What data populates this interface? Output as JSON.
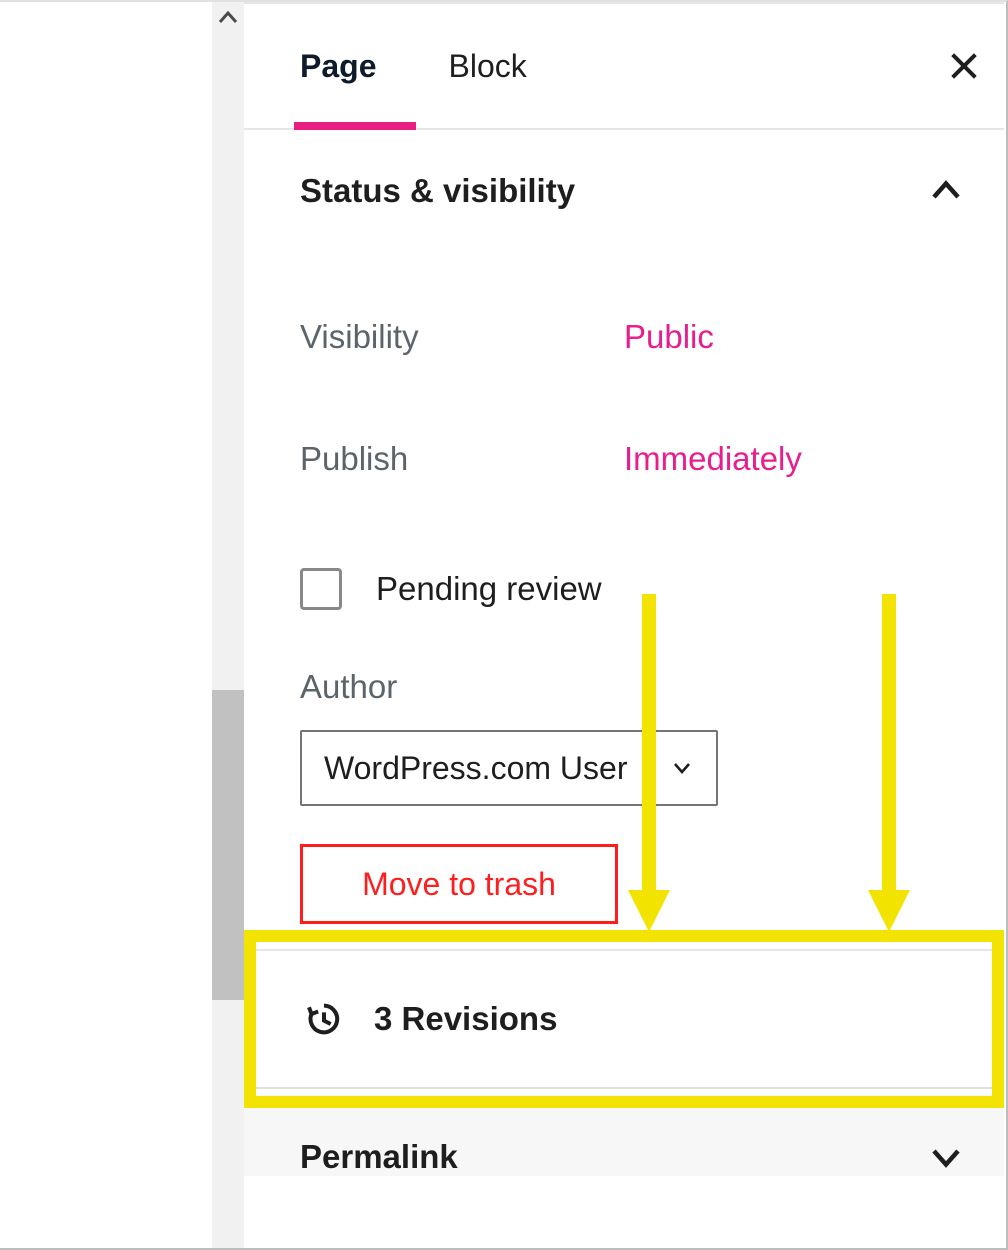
{
  "tabs": {
    "page": "Page",
    "block": "Block"
  },
  "sections": {
    "status": {
      "title": "Status & visibility",
      "visibility_label": "Visibility",
      "visibility_value": "Public",
      "publish_label": "Publish",
      "publish_value": "Immediately",
      "pending_label": "Pending review",
      "author_label": "Author",
      "author_value": "WordPress.com User",
      "trash_label": "Move to trash"
    },
    "revisions": {
      "text": "3 Revisions"
    },
    "permalink": {
      "title": "Permalink"
    }
  }
}
